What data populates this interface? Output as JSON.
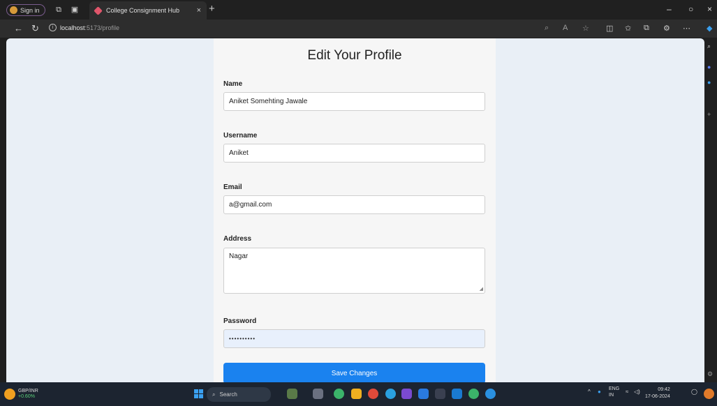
{
  "browser": {
    "profile_label": "Sign in",
    "tab_title": "College Consignment Hub",
    "url_host": "localhost",
    "url_path": ":5173/profile"
  },
  "page": {
    "title": "Edit Your Profile",
    "fields": {
      "name": {
        "label": "Name",
        "value": "Aniket Somehting Jawale"
      },
      "username": {
        "label": "Username",
        "value": "Aniket"
      },
      "email": {
        "label": "Email",
        "value": "a@gmail.com"
      },
      "address": {
        "label": "Address",
        "value": "Nagar"
      },
      "password": {
        "label": "Password",
        "value": "••••••••••"
      }
    },
    "save_label": "Save Changes"
  },
  "taskbar": {
    "widget_title": "GBP/INR",
    "widget_change": "+0.60%",
    "search_label": "Search",
    "lang_top": "ENG",
    "lang_bottom": "IN",
    "time": "09:42",
    "date": "17-06-2024"
  },
  "colors": {
    "accent": "#1a82ef",
    "page_bg": "#e9eff6",
    "card_bg": "#f6f6f6"
  }
}
